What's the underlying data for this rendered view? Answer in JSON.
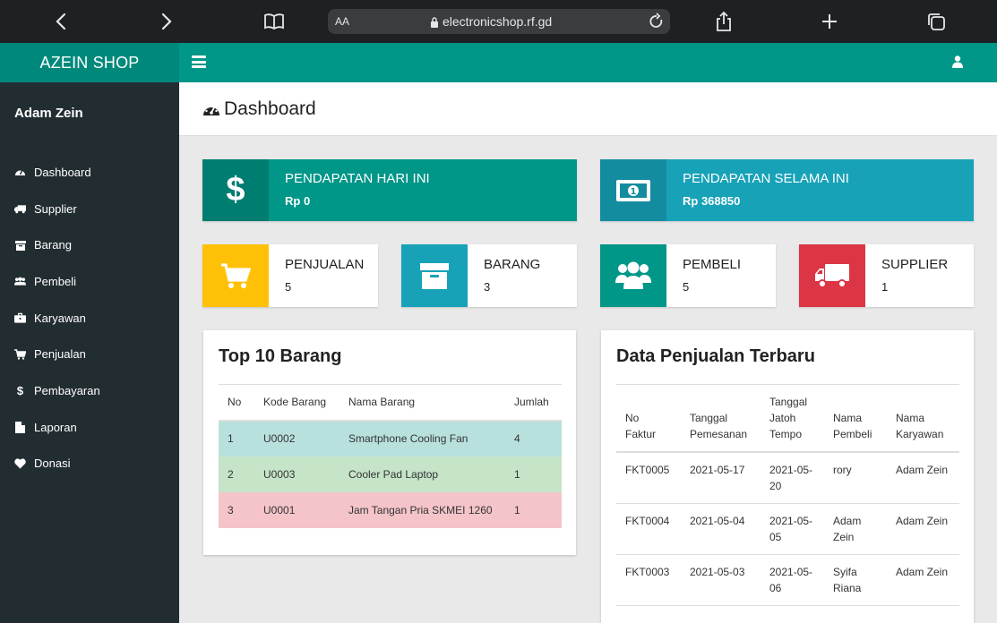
{
  "browser": {
    "text_size": "AA",
    "url": "electronicshop.rf.gd"
  },
  "brand": "AZEIN SHOP",
  "user": {
    "name": "Adam Zein"
  },
  "menu": [
    {
      "label": "Dashboard",
      "icon": "dashboard-icon"
    },
    {
      "label": "Supplier",
      "icon": "truck-icon"
    },
    {
      "label": "Barang",
      "icon": "archive-icon"
    },
    {
      "label": "Pembeli",
      "icon": "users-icon"
    },
    {
      "label": "Karyawan",
      "icon": "briefcase-icon"
    },
    {
      "label": "Penjualan",
      "icon": "cart-icon"
    },
    {
      "label": "Pembayaran",
      "icon": "dollar-icon"
    },
    {
      "label": "Laporan",
      "icon": "file-icon"
    },
    {
      "label": "Donasi",
      "icon": "heart-icon"
    }
  ],
  "page_title": "Dashboard",
  "cards": {
    "today": {
      "label": "PENDAPATAN HARI INI",
      "value": "Rp 0"
    },
    "total": {
      "label": "PENDAPATAN SELAMA INI",
      "value": "Rp 368850"
    },
    "sales": {
      "label": "PENJUALAN",
      "value": "5"
    },
    "items": {
      "label": "BARANG",
      "value": "3"
    },
    "buyers": {
      "label": "PEMBELI",
      "value": "5"
    },
    "suppliers": {
      "label": "SUPPLIER",
      "value": "1"
    }
  },
  "colors": {
    "teal": "#009688",
    "cyan": "#17a2b8",
    "yellow": "#ffc107",
    "red": "#dc3545",
    "sidebar": "#222d32"
  },
  "top_items": {
    "title": "Top 10 Barang",
    "headers": [
      "No",
      "Kode Barang",
      "Nama Barang",
      "Jumlah"
    ],
    "rows": [
      [
        "1",
        "U0002",
        "Smartphone Cooling Fan",
        "4"
      ],
      [
        "2",
        "U0003",
        "Cooler Pad Laptop",
        "1"
      ],
      [
        "3",
        "U0001",
        "Jam Tangan Pria SKMEI 1260",
        "1"
      ]
    ]
  },
  "recent_sales": {
    "title": "Data Penjualan Terbaru",
    "headers": [
      "No Faktur",
      "Tanggal Pemesanan",
      "Tanggal Jatoh Tempo",
      "Nama Pembeli",
      "Nama Karyawan"
    ],
    "rows": [
      [
        "FKT0005",
        "2021-05-17",
        "2021-05-20",
        "rory",
        "Adam Zein"
      ],
      [
        "FKT0004",
        "2021-05-04",
        "2021-05-05",
        "Adam Zein",
        "Adam Zein"
      ],
      [
        "FKT0003",
        "2021-05-03",
        "2021-05-06",
        "Syifa Riana",
        "Adam Zein"
      ]
    ]
  }
}
